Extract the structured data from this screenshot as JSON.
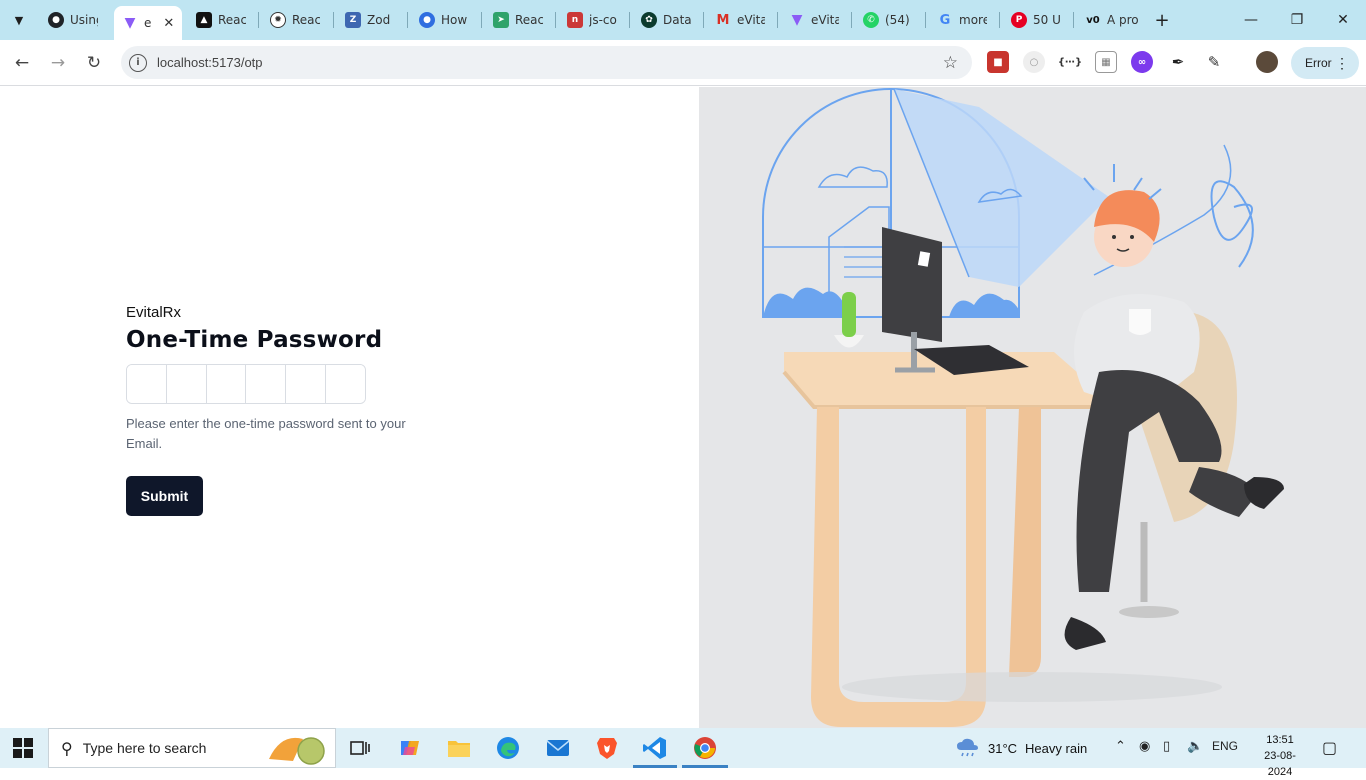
{
  "browser": {
    "tabs": [
      {
        "title": "Using",
        "icon": "github-icon",
        "color": "#1f2328"
      },
      {
        "title": "e",
        "icon": "vite-icon",
        "color": "#8b5cf6",
        "active": true
      },
      {
        "title": "React",
        "icon": "vercel-icon",
        "color": "#111111"
      },
      {
        "title": "React",
        "icon": "openai-icon",
        "color": "#333333"
      },
      {
        "title": "Zod",
        "icon": "zod-icon",
        "color": "#3e67b1"
      },
      {
        "title": "How",
        "icon": "chat-icon",
        "color": "#2f6ee0"
      },
      {
        "title": "React",
        "icon": "hook-icon",
        "color": "#2fa36b"
      },
      {
        "title": "js-co",
        "icon": "npm-icon",
        "color": "#cb3837"
      },
      {
        "title": "Data",
        "icon": "mongo-icon",
        "color": "#0b3b2e"
      },
      {
        "title": "eVita",
        "icon": "gmail-icon",
        "color": "#d93025"
      },
      {
        "title": "eVita",
        "icon": "vite-icon",
        "color": "#8b5cf6"
      },
      {
        "title": "(54)",
        "icon": "whatsapp-icon",
        "color": "#25d366"
      },
      {
        "title": "more",
        "icon": "google-icon",
        "color": "#4285f4"
      },
      {
        "title": "50 U",
        "icon": "pinterest-icon",
        "color": "#e60023"
      },
      {
        "title": "A pro",
        "icon": "v0-icon",
        "color": "#111111"
      }
    ],
    "url": "localhost:5173/otp",
    "profile_button": "Error"
  },
  "page": {
    "brand": "EvitalRx",
    "title": "One-Time Password",
    "otp_length": 6,
    "helper_text": "Please enter the one-time password sent to your Email.",
    "submit_label": "Submit"
  },
  "taskbar": {
    "search_placeholder": "Type here to search",
    "weather_temp": "31°C",
    "weather_desc": "Heavy rain",
    "language": "ENG",
    "time": "13:51",
    "date": "23-08-2024"
  }
}
